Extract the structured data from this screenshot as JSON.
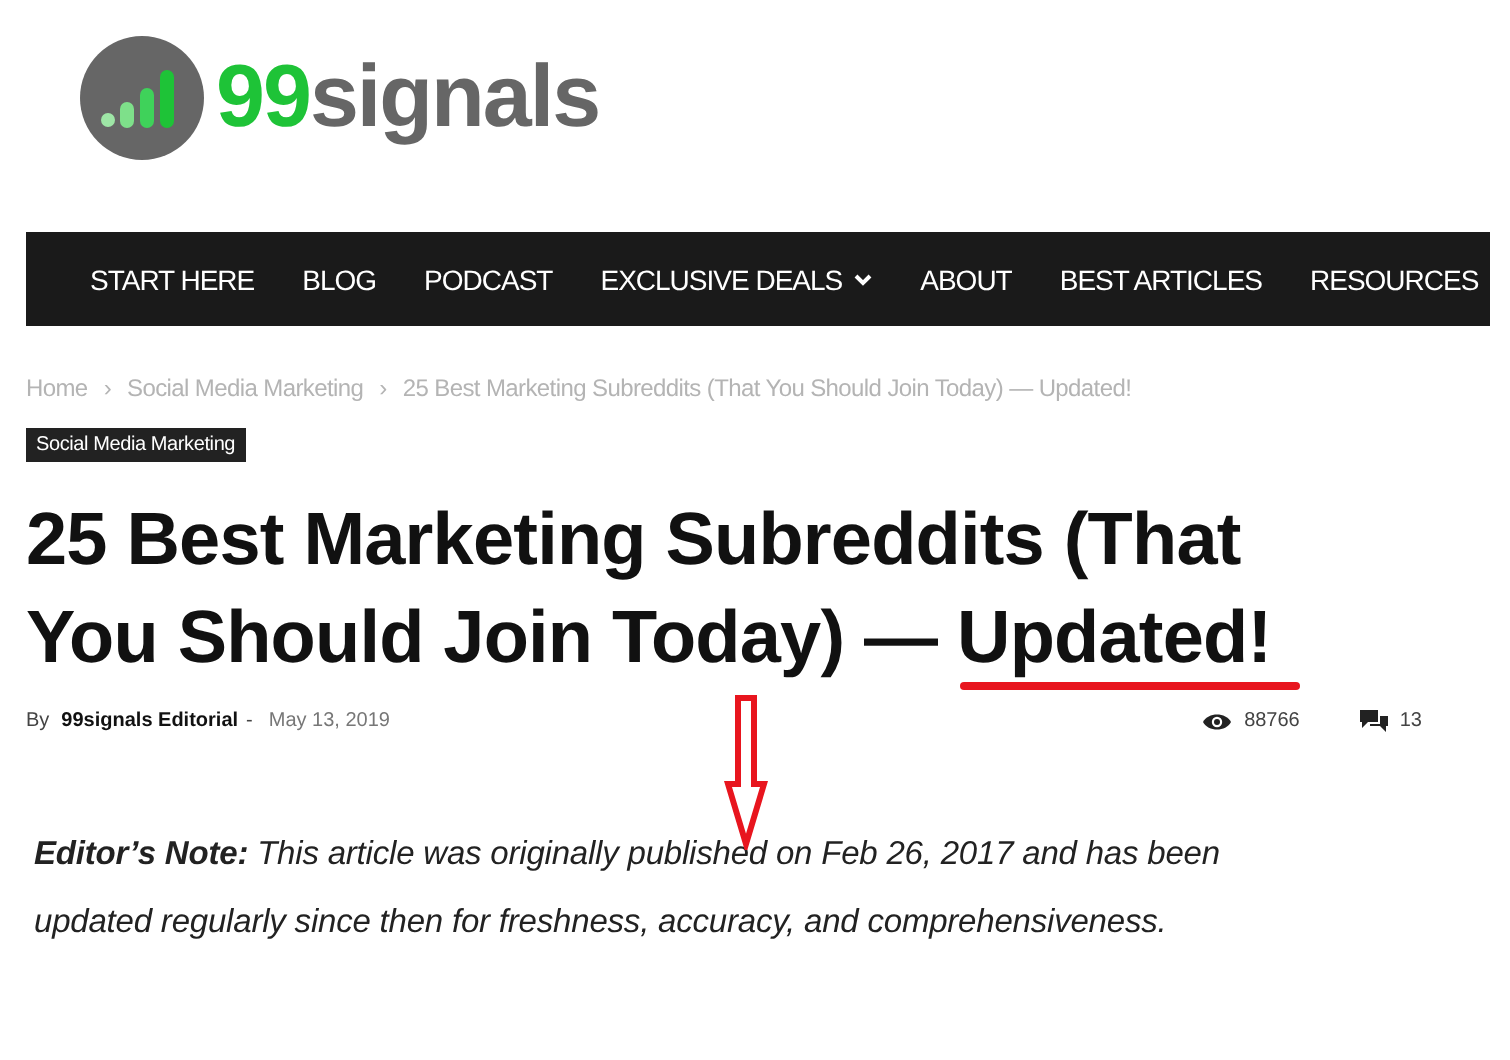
{
  "logo": {
    "number": "99",
    "word": "signals"
  },
  "nav": [
    {
      "label": "START HERE",
      "dropdown": false
    },
    {
      "label": "BLOG",
      "dropdown": false
    },
    {
      "label": "PODCAST",
      "dropdown": false
    },
    {
      "label": "EXCLUSIVE DEALS",
      "dropdown": true
    },
    {
      "label": "ABOUT",
      "dropdown": false
    },
    {
      "label": "BEST ARTICLES",
      "dropdown": false
    },
    {
      "label": "RESOURCES",
      "dropdown": false
    }
  ],
  "breadcrumb": [
    "Home",
    "Social Media Marketing",
    "25 Best Marketing Subreddits (That You Should Join Today) — Updated!"
  ],
  "breadcrumb_separator": "›",
  "category_tag": "Social Media Marketing",
  "title": {
    "main": "25 Best Marketing Subreddits (That You Should Join Today) — ",
    "highlight": "Updated!"
  },
  "meta": {
    "by": "By",
    "author": "99signals Editorial",
    "separator": "-",
    "date": "May 13, 2019",
    "views": "88766",
    "comments": "13"
  },
  "note": "**Editor’s Note:** This article was originally published on Feb 26, 2017 and has been updated regularly since then for freshness, accuracy, and comprehensiveness."
}
